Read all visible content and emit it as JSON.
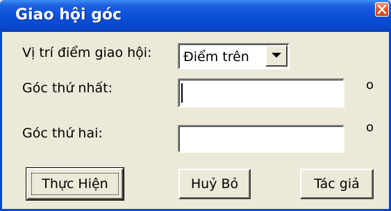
{
  "window": {
    "title": "Giao hội góc"
  },
  "form": {
    "position_label": "Vị trí điểm giao hội:",
    "position_selected": "Điểm trên",
    "first_angle_label": "Góc thứ nhất:",
    "first_angle_value": "",
    "first_angle_unit": "o",
    "second_angle_label": "Góc thứ hai:",
    "second_angle_value": "",
    "second_angle_unit": "o"
  },
  "buttons": {
    "execute_label": "Thực Hiện",
    "cancel_label": "Huỷ Bỏ",
    "author_label": "Tác giả"
  },
  "icons": {
    "close": "close-icon",
    "dropdown": "chevron-down-icon"
  },
  "colors": {
    "titlebar": "#0a4fd8",
    "close_button": "#e35a2e",
    "window_bg": "#ece9d8"
  }
}
